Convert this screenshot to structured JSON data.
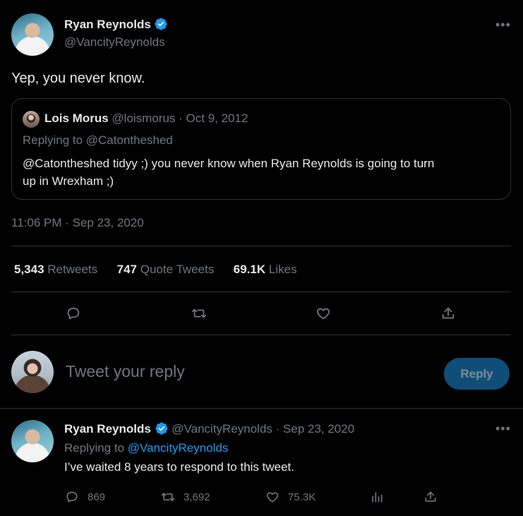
{
  "main_tweet": {
    "author_name": "Ryan Reynolds",
    "author_handle": "@VancityReynolds",
    "text": "Yep, you never know.",
    "timestamp": "11:06 PM · Sep 23, 2020",
    "more_icon": "more-icon"
  },
  "quoted_tweet": {
    "author_name": "Lois Morus",
    "author_handle": "@loismorus",
    "date": "· Oct 9, 2012",
    "replying_to": "Replying to @Catontheshed",
    "text_line1": "@Catontheshed tidyy ;) you never know when Ryan Reynolds is going to turn",
    "text_line2": "up in Wrexham ;)"
  },
  "stats": {
    "retweets_count": "5,343",
    "retweets_label": "Retweets",
    "quotes_count": "747",
    "quotes_label": "Quote Tweets",
    "likes_count": "69.1K",
    "likes_label": "Likes"
  },
  "composer": {
    "placeholder": "Tweet your reply",
    "reply_button": "Reply"
  },
  "reply_tweet": {
    "author_name": "Ryan Reynolds",
    "author_handle": "@VancityReynolds",
    "date": "· Sep 23, 2020",
    "replying_prefix": "Replying to",
    "replying_handle": "@VancityReynolds",
    "text": "I’ve waited 8 years to respond to this tweet.",
    "reply_count": "869",
    "retweet_count": "3,692",
    "like_count": "75.3K"
  },
  "colors": {
    "background": "#000000",
    "text": "#e7e9ea",
    "muted": "#71767b",
    "accent": "#1d9bf0",
    "divider": "#2f3336",
    "reply_button_bg": "#0f4e78"
  }
}
